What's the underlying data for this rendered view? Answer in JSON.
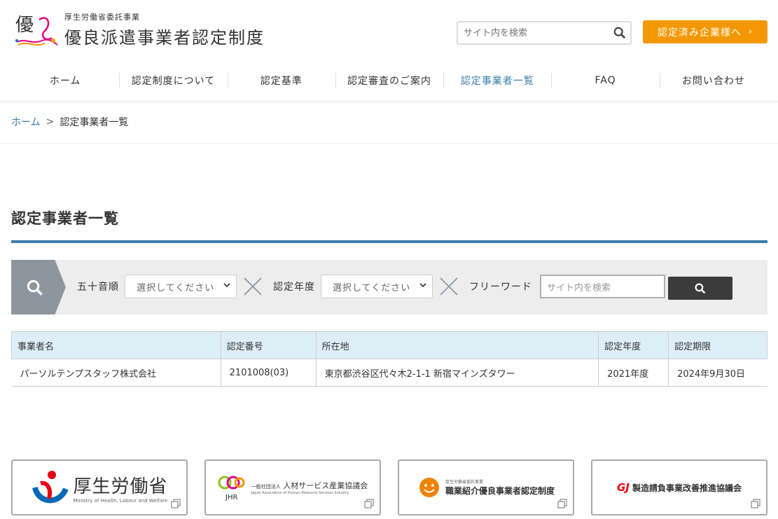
{
  "header": {
    "logo_sub": "厚生労働省委託事業",
    "logo_main": "優良派遣事業者認定制度",
    "logo_glyph": "優",
    "search_placeholder": "サイト内を検索",
    "cert_button": "認定済み企業様へ",
    "cert_arrow": "›"
  },
  "nav": [
    {
      "label": "ホーム",
      "active": false
    },
    {
      "label": "認定制度について",
      "active": false
    },
    {
      "label": "認定基準",
      "active": false
    },
    {
      "label": "認定審査のご案内",
      "active": false
    },
    {
      "label": "認定事業者一覧",
      "active": true
    },
    {
      "label": "FAQ",
      "active": false
    },
    {
      "label": "お問い合わせ",
      "active": false
    }
  ],
  "breadcrumb": {
    "home": "ホーム",
    "sep": ">",
    "current": "認定事業者一覧"
  },
  "page_title": "認定事業者一覧",
  "filter": {
    "label_kana": "五十音順",
    "select_kana": "選択してください",
    "label_year": "認定年度",
    "select_year": "選択してください",
    "label_free": "フリーワード",
    "free_placeholder": "サイト内を検索"
  },
  "table": {
    "headers": [
      "事業者名",
      "認定番号",
      "所在地",
      "認定年度",
      "認定期限"
    ],
    "rows": [
      [
        "パーソルテンプスタッフ株式会社",
        "2101008(03)",
        "東京都渋谷区代々木2-1-1 新宿マインズタワー",
        "2021年度",
        "2024年9月30日"
      ]
    ]
  },
  "banners": {
    "mhlw": {
      "title": "厚生労働省",
      "sub": "Ministry of Health, Labour and Welfare"
    },
    "jhr": {
      "mark": "JHR",
      "org_type": "一般社団法人",
      "title": "人材サービス産業協議会",
      "sub": "Japan Association of Human Resource Services Industry"
    },
    "placement": {
      "sub": "厚生労働省委託事業",
      "title": "職業紹介優良事業者認定制度"
    },
    "contract": {
      "mark": "GJ",
      "title": "製造請負事業改善推進協議会"
    }
  },
  "colors": {
    "accent": "#3a7ea8",
    "orange": "#f39800",
    "filter_bg": "#ededed",
    "table_head": "#ddeef7"
  }
}
